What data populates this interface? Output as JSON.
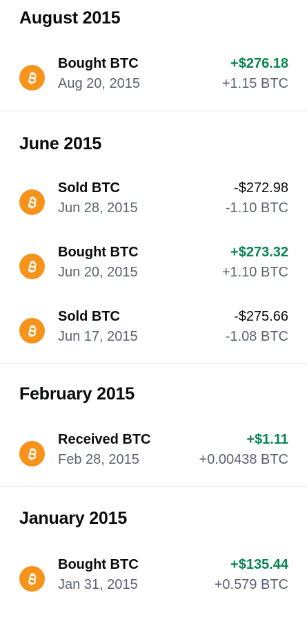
{
  "colors": {
    "positive": "#098551",
    "coin": "#f7931a",
    "secondary_text": "#5b616e"
  },
  "sections": [
    {
      "title": "August 2015",
      "transactions": [
        {
          "icon": "bitcoin-icon",
          "title": "Bought BTC",
          "date": "Aug 20, 2015",
          "fiat": "+$276.18",
          "crypto": "+1.15 BTC",
          "positive": true
        }
      ]
    },
    {
      "title": "June 2015",
      "transactions": [
        {
          "icon": "bitcoin-icon",
          "title": "Sold BTC",
          "date": "Jun 28, 2015",
          "fiat": "-$272.98",
          "crypto": "-1.10 BTC",
          "positive": false
        },
        {
          "icon": "bitcoin-icon",
          "title": "Bought BTC",
          "date": "Jun 20, 2015",
          "fiat": "+$273.32",
          "crypto": "+1.10 BTC",
          "positive": true
        },
        {
          "icon": "bitcoin-icon",
          "title": "Sold BTC",
          "date": "Jun 17, 2015",
          "fiat": "-$275.66",
          "crypto": "-1.08 BTC",
          "positive": false
        }
      ]
    },
    {
      "title": "February 2015",
      "transactions": [
        {
          "icon": "bitcoin-icon",
          "title": "Received BTC",
          "date": "Feb 28, 2015",
          "fiat": "+$1.11",
          "crypto": "+0.00438 BTC",
          "positive": true
        }
      ]
    },
    {
      "title": "January 2015",
      "transactions": [
        {
          "icon": "bitcoin-icon",
          "title": "Bought BTC",
          "date": "Jan 31, 2015",
          "fiat": "+$135.44",
          "crypto": "+0.579 BTC",
          "positive": true
        }
      ]
    }
  ]
}
